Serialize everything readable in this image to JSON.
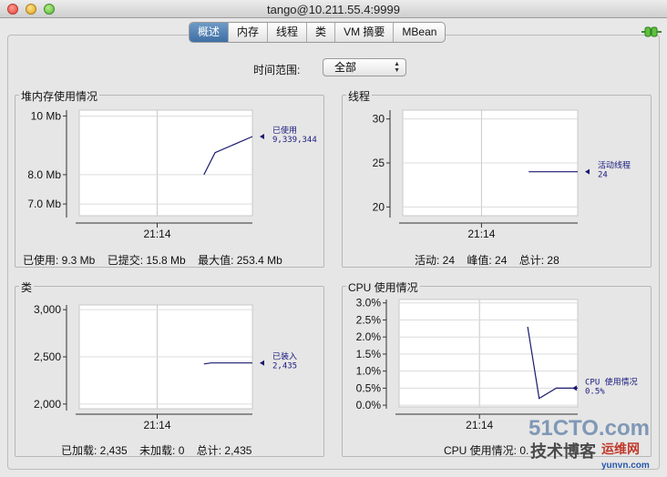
{
  "window": {
    "title": "tango@10.211.55.4:9999"
  },
  "tabs": [
    "概述",
    "内存",
    "线程",
    "类",
    "VM 摘要",
    "MBean"
  ],
  "active_tab": 0,
  "time_range": {
    "label": "时间范围:",
    "value": "全部"
  },
  "panels": {
    "heap": {
      "title": "堆内存使用情况",
      "stats": [
        "已使用: 9.3 Mb",
        "已提交: 15.8 Mb",
        "最大值: 253.4 Mb"
      ]
    },
    "threads": {
      "title": "线程",
      "stats": [
        "活动: 24",
        "峰值: 24",
        "总计: 28"
      ]
    },
    "classes": {
      "title": "类",
      "stats": [
        "已加载: 2,435",
        "未加载: 0",
        "总计: 2,435"
      ]
    },
    "cpu": {
      "title": "CPU 使用情况",
      "stats": [
        "CPU 使用情况: 0."
      ]
    }
  },
  "watermark": {
    "line1": "51CTO.com",
    "line2": "技术博客",
    "line3": "运维网",
    "line4": "yunvn.com"
  },
  "colors": {
    "series": "#1a1a6e",
    "accent": "#3f6fa3"
  },
  "chart_data": [
    {
      "type": "line",
      "title": "堆内存使用情况",
      "yticks": [
        "10 Mb",
        "8.0 Mb",
        "7.0 Mb"
      ],
      "ytick_values": [
        10,
        8,
        7
      ],
      "ylim": [
        6.6,
        10.2
      ],
      "xticks": [
        "21:14"
      ],
      "series": [
        {
          "name": "已使用",
          "x": [
            0,
            0.08,
            0.35
          ],
          "y": [
            8.0,
            8.75,
            9.3
          ]
        }
      ],
      "legend_value": "9,339,344"
    },
    {
      "type": "line",
      "title": "线程",
      "yticks": [
        "30",
        "25",
        "20"
      ],
      "ytick_values": [
        30,
        25,
        20
      ],
      "ylim": [
        19,
        31
      ],
      "xticks": [
        "21:14"
      ],
      "series": [
        {
          "name": "活动线程",
          "x": [
            0,
            0.35
          ],
          "y": [
            24,
            24
          ]
        }
      ],
      "legend_value": "24"
    },
    {
      "type": "line",
      "title": "类",
      "yticks": [
        "3,000",
        "2,500",
        "2,000"
      ],
      "ytick_values": [
        3000,
        2500,
        2000
      ],
      "ylim": [
        1950,
        3050
      ],
      "xticks": [
        "21:14"
      ],
      "series": [
        {
          "name": "已装入",
          "x": [
            0,
            0.05,
            0.35
          ],
          "y": [
            2425,
            2435,
            2435
          ]
        }
      ],
      "legend_value": "2,435"
    },
    {
      "type": "line",
      "title": "CPU 使用情况",
      "yticks": [
        "3.0%",
        "2.5%",
        "2.0%",
        "1.5%",
        "1.0%",
        "0.5%",
        "0.0%"
      ],
      "ytick_values": [
        3.0,
        2.5,
        2.0,
        1.5,
        1.0,
        0.5,
        0.0
      ],
      "ylim": [
        -0.05,
        3.1
      ],
      "xticks": [
        "21:14"
      ],
      "series": [
        {
          "name": "CPU 使用情况",
          "x": [
            0,
            0.08,
            0.2,
            0.35
          ],
          "y": [
            2.3,
            0.2,
            0.5,
            0.5
          ]
        }
      ],
      "legend_value": "0.5%"
    }
  ]
}
